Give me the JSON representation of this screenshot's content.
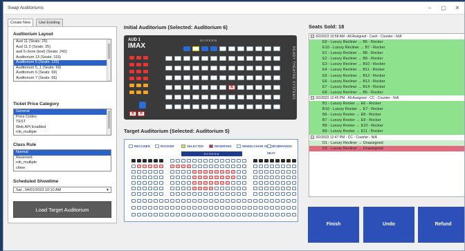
{
  "window": {
    "title": "Swap Auditoriums",
    "min": "–",
    "max": "▢",
    "close": "✕"
  },
  "tabs": [
    "Create New",
    "Use Existing"
  ],
  "left": {
    "auditorium_layout_label": "Auditorium Layout",
    "auditoriums": [
      "Aud 11 (Seats: 25)",
      "Aud 11 2 (Seats: 25)",
      "aud 5 clone (test) (Seats: 242)",
      "Auditorium 13 (Seats: 115)",
      "Auditorium 5 (Seats: 125)",
      "Auditorium 5_1 (Seats: 69)",
      "Auditorium 6 (Seats: 69)",
      "Auditorium 7 (Seats: 66)"
    ],
    "auditorium_selected_index": 4,
    "price_category_label": "Ticket Price Category",
    "price_categories": [
      "General",
      "Price Codes",
      "TEST",
      "Web API Enabled",
      "rob_multiple"
    ],
    "price_selected_index": 0,
    "class_rule_label": "Class Rule",
    "class_rules": [
      "Normal",
      "Reserved",
      "rob_multiple",
      "clone"
    ],
    "class_selected_index": 0,
    "showtime_label": "Scheduled Showtime",
    "showtime_value": "Sat , 04/01/2023 10:10 AM",
    "load_button": "Load Target Auditorium"
  },
  "initial": {
    "title": "Initial Auditorium (Selected: Auditorium 6)",
    "logo_line1": "AUD 1",
    "logo_line2": "IMAX",
    "screen_label": "SCREEN",
    "side_text": "READY THEATRE SYSTEMS"
  },
  "target": {
    "title": "Target Auditorium (Selected: Auditorium 5)",
    "screen_label": "SCREEN",
    "legend": [
      "RECLINER",
      "ROCKER",
      "SELECTED",
      "RESERVED",
      "WHEELCHAIR SPACE",
      "COMPANION SEAT"
    ]
  },
  "sales": {
    "seats_sold_label": "Seats Sold:",
    "seats_sold_value": "18",
    "groups": [
      {
        "header": "3/2/2023 10:58 AM - All Assigned - Cash - Counter - N/A",
        "rows": [
          "E9 - Luxury Recliner → B6 - Rocker",
          "E10 - Luxury Recliner → B7 - Rocker",
          "E1 - Luxury Recliner → B8 - Rocker",
          "E2 - Luxury Recliner → B9 - Rocker",
          "E3 - Luxury Recliner → B10 - Rocker",
          "E4 - Luxury Recliner → B11 - Rocker",
          "E5 - Luxury Recliner → B12 - Rocker",
          "E6 - Luxury Recliner → B13 - Rocker",
          "E7 - Luxury Recliner → B14 - Rocker",
          "E8 - Luxury Recliner → B5 - Rocker"
        ]
      },
      {
        "header": "3/2/2023 12:45 PM - All Assigned - CC - Counter - N/A",
        "rows": [
          "B1 - Luxury Rocker → E6 - Rocker",
          "B10 - Luxury Rocker → E7 - Rocker",
          "B6 - Luxury Rocker → E8 - Rocker",
          "B7 - Luxury Rocker → E9 - Rocker",
          "B8 - Luxury Rocker → E10 - Rocker",
          "B9 - Luxury Rocker → E11 - Rocker"
        ]
      },
      {
        "header": "3/2/2023 12:47 PM - CC - Counter - N/A",
        "rows": [
          "D1 - Luxury Recliner → Unassigned",
          "D2 - Luxury Recliner → Unassigned"
        ]
      }
    ]
  },
  "buttons": {
    "finish": "Finish",
    "undo": "Undo",
    "refund": "Refund"
  },
  "colors": {
    "assigned": "#8ee28e",
    "unassigned_selected": "#e26b80",
    "button_blue": "#2d4fb8"
  }
}
